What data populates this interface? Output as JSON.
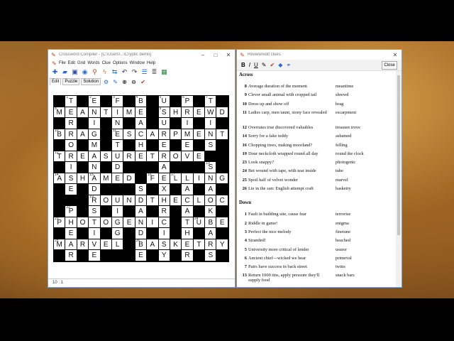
{
  "main_window": {
    "title": "Crossword Compiler - [C:\\Users\\...\\Cryptic demo]",
    "menu": [
      "File",
      "Edit",
      "Grid",
      "Words",
      "Clue",
      "Options",
      "Window",
      "Help"
    ],
    "toolbar_icons": [
      "add-icon",
      "open-icon",
      "save-icon",
      "target-icon",
      "lightning-icon",
      "search-icon",
      "link-icon",
      "undo-icon",
      "redo-icon",
      "list-icon",
      "list-icon",
      "image-icon"
    ],
    "mode_tabs": [
      "Edit",
      "Puzzle",
      "Solution"
    ],
    "status": "10 : 1"
  },
  "grid": {
    "rows": [
      ".T.E.F.B.U.P.T.",
      "MEANTIME.SHREWD",
      ".R.I.N.A.U.I.I.",
      "BRAG.ESCARPMENT",
      ".O.M.T.H.E.E.S.",
      "TREASURETROVE..",
      ".I.N.D...A...S.",
      "ASHAMED.FELLING",
      ".E.D...S.X.A.A.",
      "...ROUNDTHECLOCK",
      ".P.S.I.A.R.A.K.",
      "PHOTOGENIC.TUBE",
      ".E.I.G.D.I.H.A.",
      "MARVEL.BASKETRY",
      ".R.E...E.Y.R.S."
    ],
    "numbers": [
      {
        "r": 0,
        "c": 1,
        "n": "1"
      },
      {
        "r": 0,
        "c": 3,
        "n": "2"
      },
      {
        "r": 0,
        "c": 5,
        "n": "3"
      },
      {
        "r": 0,
        "c": 7,
        "n": "4"
      },
      {
        "r": 0,
        "c": 9,
        "n": "5"
      },
      {
        "r": 0,
        "c": 11,
        "n": "6"
      },
      {
        "r": 0,
        "c": 13,
        "n": "7"
      },
      {
        "r": 1,
        "c": 0,
        "n": "8"
      },
      {
        "r": 1,
        "c": 9,
        "n": "9"
      },
      {
        "r": 3,
        "c": 0,
        "n": "10"
      },
      {
        "r": 3,
        "c": 5,
        "n": "11"
      },
      {
        "r": 5,
        "c": 0,
        "n": "12"
      },
      {
        "r": 6,
        "c": 13,
        "n": "13"
      },
      {
        "r": 7,
        "c": 0,
        "n": "14"
      },
      {
        "r": 7,
        "c": 3,
        "n": "15"
      },
      {
        "r": 7,
        "c": 8,
        "n": "16"
      },
      {
        "r": 7,
        "c": 10,
        "n": "17"
      },
      {
        "r": 9,
        "c": 3,
        "n": "19"
      },
      {
        "r": 10,
        "c": 1,
        "n": "22"
      },
      {
        "r": 11,
        "c": 0,
        "n": "23"
      },
      {
        "r": 11,
        "c": 12,
        "n": "24"
      },
      {
        "r": 13,
        "c": 0,
        "n": "25"
      },
      {
        "r": 13,
        "c": 7,
        "n": "26"
      }
    ]
  },
  "clues_window": {
    "title": "Review/edit clues",
    "close_label": "Close",
    "toolbar": [
      "B",
      "I",
      "U",
      "✎",
      "✔",
      "◆",
      "⚭"
    ],
    "across_label": "Across",
    "down_label": "Down",
    "across": [
      {
        "n": "8",
        "text": "Average duration of the moment",
        "answer": "meantime"
      },
      {
        "n": "9",
        "text": "Clever small animal with cropped tail",
        "answer": "shrewd"
      },
      {
        "n": "10",
        "text": "Dress up and show off",
        "answer": "brag"
      },
      {
        "n": "11",
        "text": "Ladies carp, men taunt, stony face revealed",
        "answer": "escarpment"
      },
      {
        "n": "12",
        "text": "Overrates true discovered valuables",
        "answer": "treasure trove"
      },
      {
        "n": "14",
        "text": "Sorry for a fake teddy",
        "answer": "ashamed"
      },
      {
        "n": "16",
        "text": "Chopping trees, making moorland?",
        "answer": "felling"
      },
      {
        "n": "19",
        "text": "Dour neckcloth wrapped round all day",
        "answer": "round the clock"
      },
      {
        "n": "23",
        "text": "Look snappy?",
        "answer": "photogenic"
      },
      {
        "n": "24",
        "text": "Bet wound with tape, with tear inside",
        "answer": "tube"
      },
      {
        "n": "25",
        "text": "Spoil half of velvet wonder",
        "answer": "marvel"
      },
      {
        "n": "26",
        "text": "Lie in the sun: English attempt craft",
        "answer": "basketry"
      }
    ],
    "down": [
      {
        "n": "1",
        "text": "Fault in building site, cause fear",
        "answer": "terrorise"
      },
      {
        "n": "2",
        "text": "Riddle in game!",
        "answer": "enigma"
      },
      {
        "n": "3",
        "text": "Perfect the nice melody",
        "answer": "finetune"
      },
      {
        "n": "4",
        "text": "Stranded!",
        "answer": "beached"
      },
      {
        "n": "5",
        "text": "University more critical of lender",
        "answer": "usurer"
      },
      {
        "n": "6",
        "text": "Ancient chief—wicked we hear",
        "answer": "primeval"
      },
      {
        "n": "7",
        "text": "Pairs have success in back street",
        "answer": "twins"
      },
      {
        "n": "13",
        "text": "Return 1000 tins, apply pressure they'll supply food",
        "answer": "snack bars"
      }
    ]
  }
}
